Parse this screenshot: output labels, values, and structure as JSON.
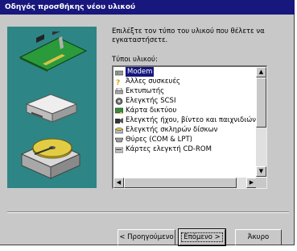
{
  "window": {
    "title": "Οδηγός προσθήκης νέου υλικού"
  },
  "instructions": "Επιλέξτε τον τύπο του υλικού που θέλετε να εγκαταστήσετε.",
  "list": {
    "label": "Τύποι υλικού:",
    "items": [
      {
        "label": "Modem",
        "icon": "modem-icon",
        "selected": true
      },
      {
        "label": "Άλλες συσκευές",
        "icon": "question-device-icon",
        "selected": false
      },
      {
        "label": "Εκτυπωτής",
        "icon": "printer-icon",
        "selected": false
      },
      {
        "label": "Ελεγκτής SCSI",
        "icon": "scsi-controller-icon",
        "selected": false
      },
      {
        "label": "Κάρτα δικτύου",
        "icon": "network-card-icon",
        "selected": false
      },
      {
        "label": "Ελεγκτής ήχου, βίντεο και παιχνιδιών",
        "icon": "sound-video-game-icon",
        "selected": false
      },
      {
        "label": "Ελεγκτής σκληρών δίσκων",
        "icon": "hard-disk-controller-icon",
        "selected": false
      },
      {
        "label": "Θύρες (COM & LPT)",
        "icon": "ports-icon",
        "selected": false
      },
      {
        "label": "Κάρτες ελεγκτή CD-ROM",
        "icon": "cdrom-controller-icon",
        "selected": false
      }
    ]
  },
  "buttons": {
    "back": "< Προηγούμενο",
    "next": "Επόμενο >",
    "cancel": "Άκυρο"
  },
  "scroll": {
    "up": "▲",
    "down": "▼",
    "left": "◀",
    "right": "▶"
  },
  "colors": {
    "titlebar": "#17177e",
    "art_panel": "#2e8585",
    "selection": "#17177e"
  }
}
